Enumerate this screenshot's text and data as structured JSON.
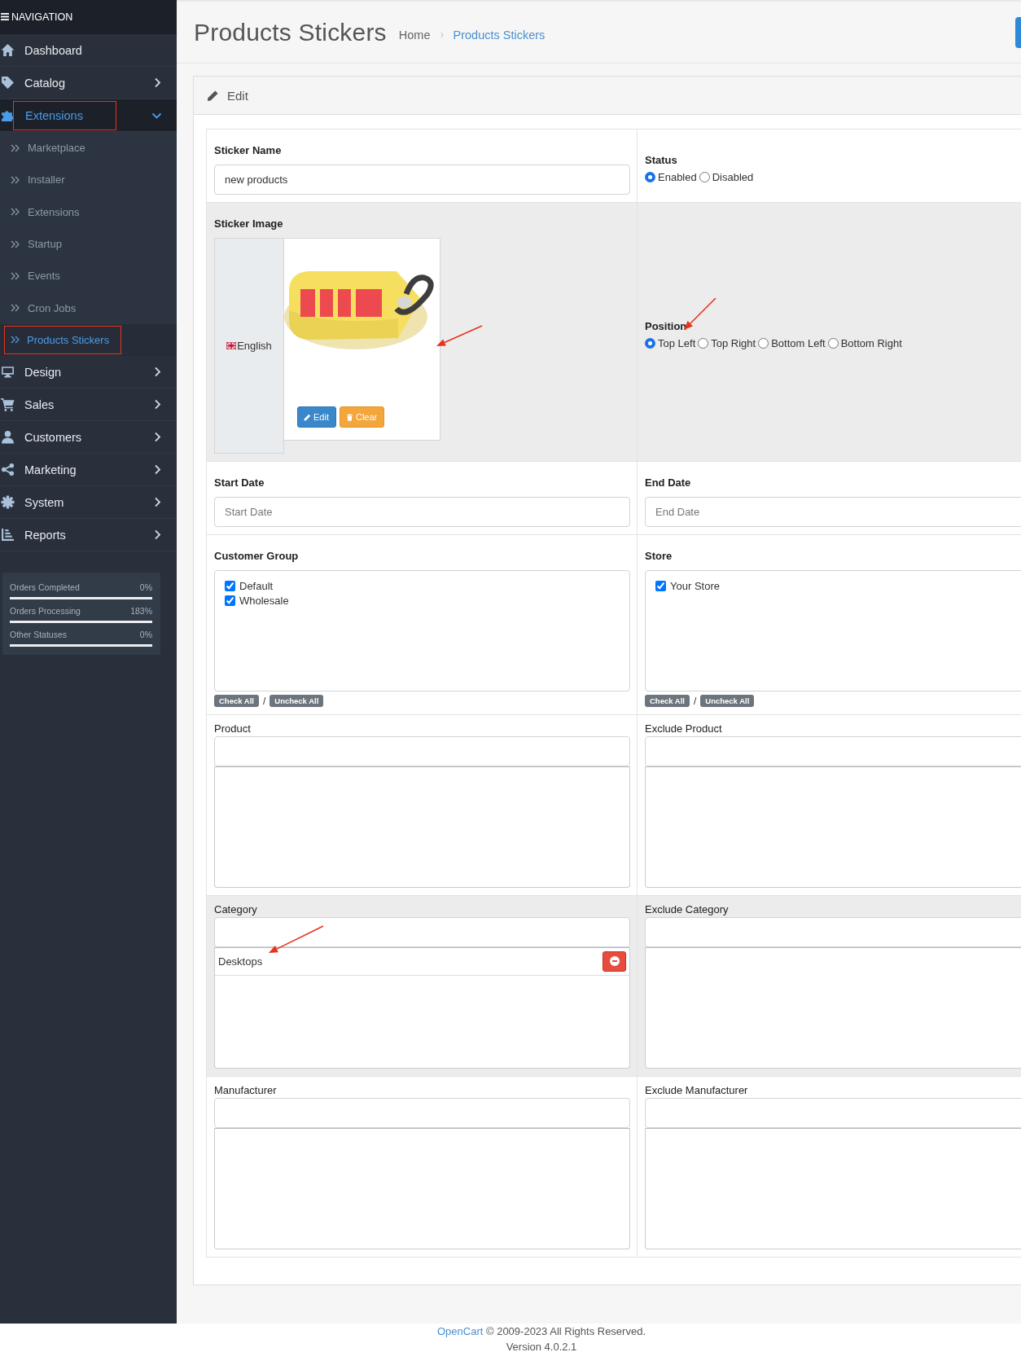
{
  "navigation": {
    "title": "NAVIGATION",
    "items": [
      {
        "label": "Dashboard",
        "selected": false,
        "annotated": false
      },
      {
        "label": "Catalog",
        "selected": false,
        "annotated": false,
        "expanded": false
      },
      {
        "label": "Extensions",
        "selected": true,
        "annotated": true,
        "expanded": true,
        "children": [
          {
            "label": "Marketplace",
            "selected": false,
            "annotated": false
          },
          {
            "label": "Installer",
            "selected": false,
            "annotated": false
          },
          {
            "label": "Extensions",
            "selected": false,
            "annotated": false
          },
          {
            "label": "Startup",
            "selected": false,
            "annotated": false
          },
          {
            "label": "Events",
            "selected": false,
            "annotated": false
          },
          {
            "label": "Cron Jobs",
            "selected": false,
            "annotated": false
          },
          {
            "label": "Products Stickers",
            "selected": true,
            "annotated": true
          }
        ]
      },
      {
        "label": "Design",
        "selected": false,
        "annotated": false,
        "expanded": false
      },
      {
        "label": "Sales",
        "selected": false,
        "annotated": false,
        "expanded": false
      },
      {
        "label": "Customers",
        "selected": false,
        "annotated": false,
        "expanded": false
      },
      {
        "label": "Marketing",
        "selected": false,
        "annotated": false,
        "expanded": false
      },
      {
        "label": "System",
        "selected": false,
        "annotated": false,
        "expanded": false
      },
      {
        "label": "Reports",
        "selected": false,
        "annotated": false,
        "expanded": false
      }
    ]
  },
  "stats": [
    {
      "label": "Orders Completed",
      "value": "0%",
      "level": 0
    },
    {
      "label": "Orders Processing",
      "value": "183%",
      "level": 0
    },
    {
      "label": "Other Statuses",
      "value": "0%",
      "level": 0
    }
  ],
  "page_header": {
    "title": "Products Stickers",
    "breadcrumbs": [
      {
        "label": "Home",
        "selected": false
      },
      {
        "label": "Products Stickers",
        "selected": true
      }
    ]
  },
  "card": {
    "title": "Edit",
    "rows": [
      {
        "shaded": false,
        "cells": [
          {
            "kind": "text",
            "label": "Sticker Name",
            "value": "new products"
          },
          {
            "kind": "radio",
            "label": "Status",
            "options": [
              {
                "label": "Enabled",
                "selected": true
              },
              {
                "label": "Disabled",
                "selected": false
              }
            ]
          }
        ]
      },
      {
        "shaded": true,
        "cells": [
          {
            "label": "Sticker Image",
            "language": "English",
            "buttons": [
              {
                "label": "Edit",
                "kind": "primary"
              },
              {
                "label": "Clear",
                "kind": "warning"
              }
            ]
          },
          {
            "kind": "radio",
            "label": "Position",
            "options": [
              {
                "label": "Top Left",
                "selected": true
              },
              {
                "label": "Top Right",
                "selected": false
              },
              {
                "label": "Bottom Left",
                "selected": false
              },
              {
                "label": "Bottom Right",
                "selected": false
              }
            ]
          }
        ]
      },
      {
        "shaded": false,
        "cells": [
          {
            "kind": "text",
            "label": "Start Date",
            "placeholder": "Start Date"
          },
          {
            "kind": "text",
            "label": "End Date",
            "placeholder": "End Date"
          }
        ]
      },
      {
        "shaded": false,
        "cells": [
          {
            "kind": "checklist",
            "label": "Customer Group",
            "options": [
              {
                "label": "Default",
                "checked": true
              },
              {
                "label": "Wholesale",
                "checked": true
              }
            ],
            "check_all": "Check All",
            "separator": "/",
            "uncheck_all": "Uncheck All"
          },
          {
            "kind": "checklist",
            "label": "Store",
            "options": [
              {
                "label": "Your Store",
                "checked": true
              }
            ],
            "check_all": "Check All",
            "separator": "/",
            "uncheck_all": "Uncheck All"
          }
        ]
      },
      {
        "shaded": false,
        "cells": [
          {
            "kind": "autocomplete",
            "label": "Product"
          },
          {
            "kind": "autocomplete",
            "label": "Exclude Product"
          }
        ]
      },
      {
        "shaded": true,
        "cells": [
          {
            "kind": "autocomplete",
            "label": "Category",
            "items": [
              {
                "label": "Desktops"
              }
            ]
          },
          {
            "kind": "autocomplete",
            "label": "Exclude Category"
          }
        ]
      },
      {
        "shaded": false,
        "cells": [
          {
            "kind": "autocomplete",
            "label": "Manufacturer"
          },
          {
            "kind": "autocomplete",
            "label": "Exclude Manufacturer"
          }
        ]
      }
    ]
  },
  "footer": {
    "link": "OpenCart",
    "text": "© 2009-2023 All Rights Reserved.",
    "version": "Version 4.0.2.1"
  }
}
